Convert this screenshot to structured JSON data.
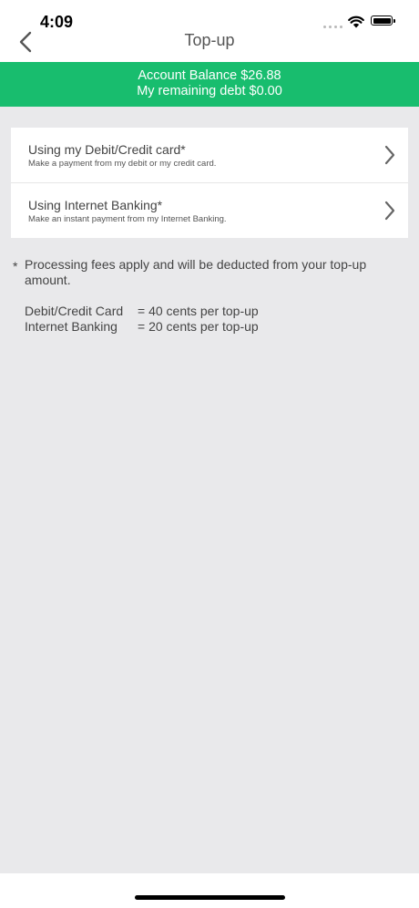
{
  "status_bar": {
    "time": "4:09"
  },
  "header": {
    "title": "Top-up"
  },
  "balance": {
    "line1": "Account Balance $26.88",
    "line2": "My remaining debt $0.00",
    "color": "#18bd6e"
  },
  "options": [
    {
      "title": "Using my Debit/Credit card*",
      "desc": "Make a payment from my debit or my credit card."
    },
    {
      "title": "Using Internet Banking*",
      "desc": "Make an instant payment from my Internet Banking."
    }
  ],
  "notes": {
    "star": "*",
    "text": "Processing fees apply and will be deducted from your top-up amount.",
    "fees": [
      {
        "label": "Debit/Credit Card",
        "value": "= 40 cents per top-up"
      },
      {
        "label": "Internet Banking",
        "value": "= 20 cents per top-up"
      }
    ]
  }
}
